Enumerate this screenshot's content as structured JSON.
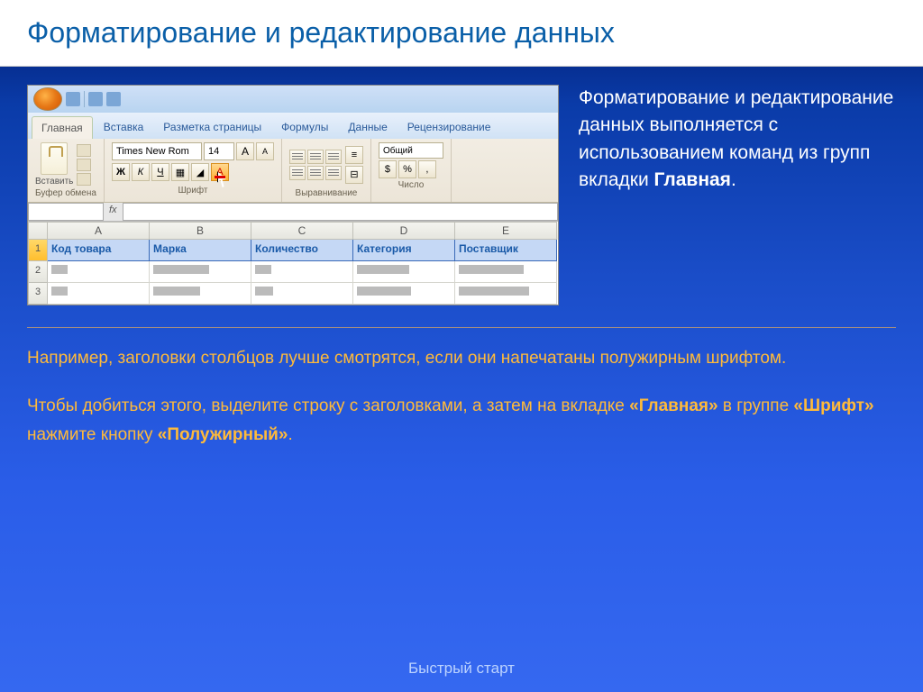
{
  "title": "Форматирование и редактирование данных",
  "side_text_pre": "Форматирование и редактирование данных выполняется с использованием команд из групп вкладки ",
  "side_text_bold": "Главная",
  "side_text_post": ".",
  "bottom": {
    "p1": "Например, заголовки столбцов лучше смотрятся, если они напечатаны полужирным шрифтом.",
    "p2_pre": "Чтобы добиться этого, выделите строку с заголовками, а затем на вкладке ",
    "p2_b1": "«Главная»",
    "p2_mid1": " в группе ",
    "p2_b2": "«Шрифт»",
    "p2_mid2": " нажмите кнопку ",
    "p2_b3": "«Полужирный»",
    "p2_end": "."
  },
  "footer": "Быстрый старт",
  "excel": {
    "tabs": [
      "Главная",
      "Вставка",
      "Разметка страницы",
      "Формулы",
      "Данные",
      "Рецензирование"
    ],
    "paste_label": "Вставить",
    "groups": {
      "clip": "Буфер обмена",
      "font": "Шрифт",
      "align": "Выравнивание",
      "num": "Число"
    },
    "font_name": "Times New Rom",
    "font_size": "14",
    "bold": "Ж",
    "italic": "К",
    "underline": "Ч",
    "grow": "A",
    "shrink": "A",
    "fcolor": "A",
    "num_format": "Общий",
    "cols": [
      "A",
      "B",
      "C",
      "D",
      "E"
    ],
    "headers": [
      "Код товара",
      "Марка",
      "Количество",
      "Категория",
      "Поставщик"
    ],
    "rows": [
      "1",
      "2",
      "3"
    ]
  }
}
